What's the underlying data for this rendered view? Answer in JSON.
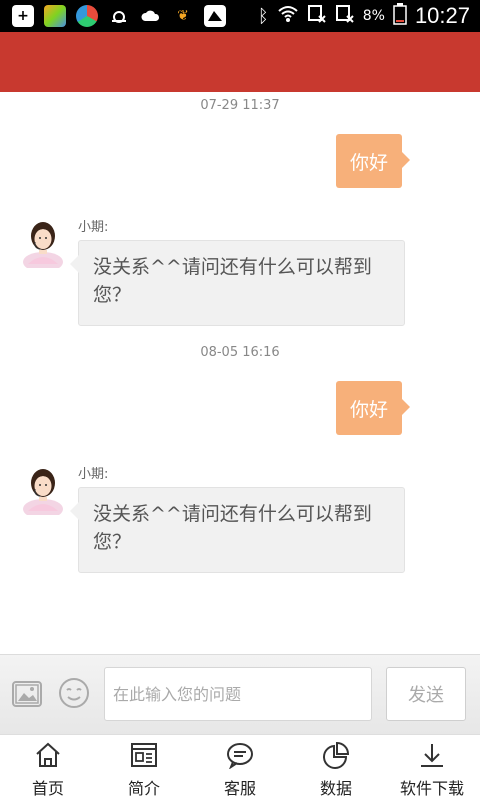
{
  "status_bar": {
    "battery": "8%",
    "time": "10:27"
  },
  "header": {
    "bg_color": "#c8392f"
  },
  "chat": {
    "messages": [
      {
        "timestamp": "07-29 11:37",
        "outgoing": "你好",
        "sender": "小期:",
        "reply": "没关系^^请问还有什么可以帮到您？"
      },
      {
        "timestamp": "08-05 16:16",
        "outgoing": "你好",
        "sender": "小期:",
        "reply": "没关系^^请问还有什么可以帮到您？"
      }
    ],
    "outgoing_bubble_color": "#f7b07a"
  },
  "input_bar": {
    "placeholder": "在此输入您的问题",
    "send_label": "发送",
    "image_icon": "image-icon",
    "emoji_icon": "emoji-icon"
  },
  "bottom_nav": {
    "items": [
      {
        "label": "首页",
        "icon": "home-icon"
      },
      {
        "label": "简介",
        "icon": "intro-icon"
      },
      {
        "label": "客服",
        "icon": "chat-icon"
      },
      {
        "label": "数据",
        "icon": "pie-chart-icon"
      },
      {
        "label": "软件下载",
        "icon": "download-icon"
      }
    ]
  }
}
